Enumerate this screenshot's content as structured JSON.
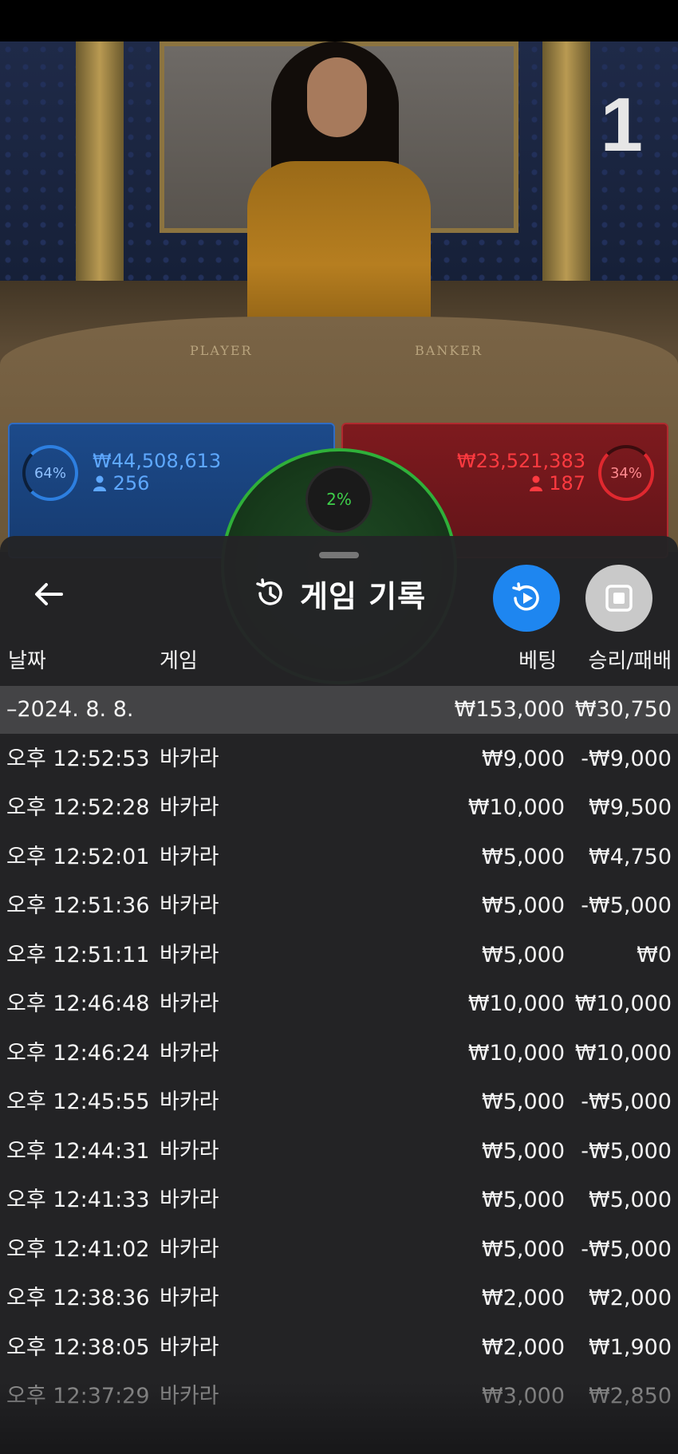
{
  "video": {
    "round_number": "1",
    "table_player_text": "PLAYER",
    "table_banker_text": "BANKER"
  },
  "bets": {
    "player": {
      "percent": "64%",
      "amount": "₩44,508,613",
      "count": "256"
    },
    "banker": {
      "percent": "34%",
      "amount": "₩23,521,383",
      "count": "187"
    },
    "tie": {
      "percent": "2%"
    }
  },
  "sheet": {
    "title": "게임 기록",
    "columns": {
      "date": "날짜",
      "game": "게임",
      "bet": "베팅",
      "winloss": "승리/패배"
    },
    "summary": {
      "date": "–2024. 8. 8.",
      "bet": "₩153,000",
      "winloss": "₩30,750"
    },
    "rows": [
      {
        "time": "오후 12:52:53",
        "game": "바카라",
        "bet": "₩9,000",
        "winloss": "-₩9,000"
      },
      {
        "time": "오후 12:52:28",
        "game": "바카라",
        "bet": "₩10,000",
        "winloss": "₩9,500"
      },
      {
        "time": "오후 12:52:01",
        "game": "바카라",
        "bet": "₩5,000",
        "winloss": "₩4,750"
      },
      {
        "time": "오후 12:51:36",
        "game": "바카라",
        "bet": "₩5,000",
        "winloss": "-₩5,000"
      },
      {
        "time": "오후 12:51:11",
        "game": "바카라",
        "bet": "₩5,000",
        "winloss": "₩0"
      },
      {
        "time": "오후 12:46:48",
        "game": "바카라",
        "bet": "₩10,000",
        "winloss": "₩10,000"
      },
      {
        "time": "오후 12:46:24",
        "game": "바카라",
        "bet": "₩10,000",
        "winloss": "₩10,000"
      },
      {
        "time": "오후 12:45:55",
        "game": "바카라",
        "bet": "₩5,000",
        "winloss": "-₩5,000"
      },
      {
        "time": "오후 12:44:31",
        "game": "바카라",
        "bet": "₩5,000",
        "winloss": "-₩5,000"
      },
      {
        "time": "오후 12:41:33",
        "game": "바카라",
        "bet": "₩5,000",
        "winloss": "₩5,000"
      },
      {
        "time": "오후 12:41:02",
        "game": "바카라",
        "bet": "₩5,000",
        "winloss": "-₩5,000"
      },
      {
        "time": "오후 12:38:36",
        "game": "바카라",
        "bet": "₩2,000",
        "winloss": "₩2,000"
      },
      {
        "time": "오후 12:38:05",
        "game": "바카라",
        "bet": "₩2,000",
        "winloss": "₩1,900"
      },
      {
        "time": "오후 12:37:29",
        "game": "바카라",
        "bet": "₩3,000",
        "winloss": "₩2,850"
      }
    ]
  },
  "colors": {
    "play_button": "#1e86f0",
    "player_blue": "#5ea8ff",
    "banker_red": "#ff3a40",
    "tie_green": "#3ecf4a"
  },
  "icons": {
    "back": "arrow-left-icon",
    "history": "history-icon",
    "replay": "replay-icon",
    "stop": "stop-icon",
    "person": "person-icon"
  }
}
